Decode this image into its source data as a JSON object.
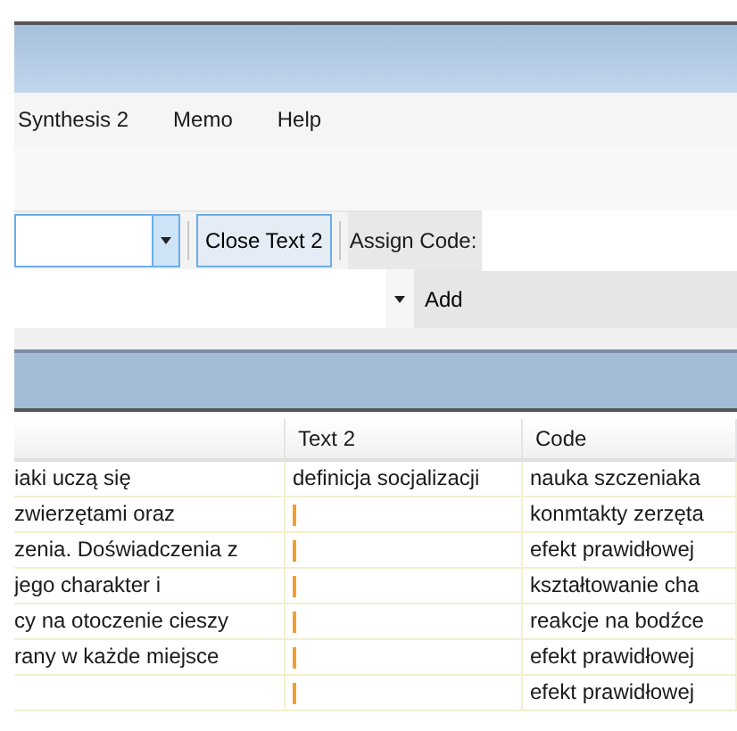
{
  "menu": [
    {
      "label": "Synthesis 2"
    },
    {
      "label": "Memo"
    },
    {
      "label": "Help"
    }
  ],
  "toolbar": {
    "close_button": {
      "label": "Close Text 2",
      "focused": true
    },
    "assign_label": "Assign Code:",
    "add_button": {
      "label": "Add"
    }
  },
  "table": {
    "columns": [
      "Text 2",
      "Code"
    ],
    "rows": [
      {
        "text": "iaki uczą się",
        "text_2": "definicja socjalizacji",
        "code": "nauka szczeniaka"
      },
      {
        "text": " zwierzętami oraz",
        "marked": true,
        "code": "konmtakty zerzęta"
      },
      {
        "text": "zenia. Doświadczenia z",
        "marked": true,
        "code": "efekt prawidłowej"
      },
      {
        "text": " jego charakter i",
        "marked": true,
        "code": "kształtowanie cha"
      },
      {
        "text": "cy na otoczenie cieszy",
        "marked": true,
        "code": "reakcje na bodźce"
      },
      {
        "text": "rany w każde miejsce",
        "marked": true,
        "code": "efekt prawidłowej"
      },
      {
        "text": "",
        "marked": true,
        "code": "efekt prawidłowej"
      }
    ]
  }
}
